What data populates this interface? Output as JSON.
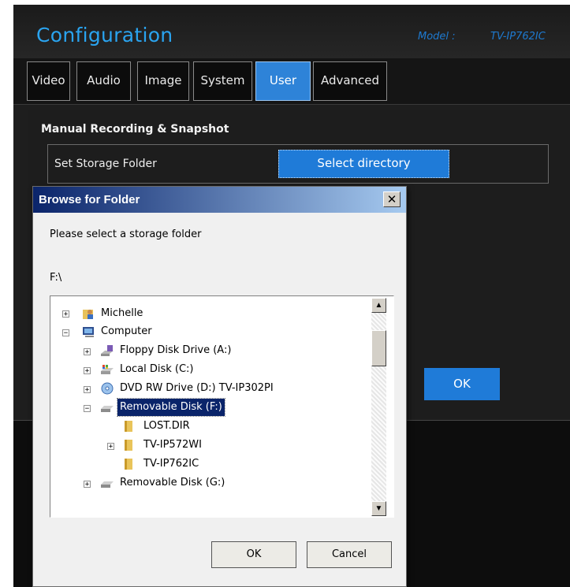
{
  "header": {
    "title": "Configuration",
    "model_label": "Model :",
    "model_value": "TV-IP762IC"
  },
  "tabs": [
    {
      "label": "Video"
    },
    {
      "label": "Audio"
    },
    {
      "label": "Image"
    },
    {
      "label": "System"
    },
    {
      "label": "User",
      "active": true
    },
    {
      "label": "Advanced"
    }
  ],
  "section": {
    "title": "Manual Recording & Snapshot",
    "row_label": "Set Storage Folder",
    "select_button": "Select directory",
    "ok_button": "OK"
  },
  "dialog": {
    "title": "Browse for Folder",
    "close_glyph": "✕",
    "prompt": "Please select a storage folder",
    "path": "F:\\",
    "tree": [
      {
        "label": "Michelle",
        "icon": "user-folder-icon",
        "expander": "+"
      },
      {
        "label": "Computer",
        "icon": "computer-icon",
        "expander": "−"
      },
      {
        "label": "Floppy Disk Drive (A:)",
        "icon": "floppy-drive-icon",
        "expander": "+"
      },
      {
        "label": "Local Disk (C:)",
        "icon": "local-disk-icon",
        "expander": "+"
      },
      {
        "label": "DVD RW Drive (D:) TV-IP302PI",
        "icon": "dvd-drive-icon",
        "expander": "+"
      },
      {
        "label": "Removable Disk (F:)",
        "icon": "removable-disk-icon",
        "expander": "−",
        "selected": true
      },
      {
        "label": "LOST.DIR",
        "icon": "folder-icon",
        "expander": ""
      },
      {
        "label": "TV-IP572WI",
        "icon": "folder-icon",
        "expander": "+"
      },
      {
        "label": "TV-IP762IC",
        "icon": "folder-icon",
        "expander": ""
      },
      {
        "label": "Removable Disk (G:)",
        "icon": "removable-disk-icon",
        "expander": "+"
      }
    ],
    "ok_button": "OK",
    "cancel_button": "Cancel",
    "scroll_up_glyph": "▲",
    "scroll_down_glyph": "▼"
  },
  "colors": {
    "accent_blue": "#2e83d8",
    "title_blue": "#2aa4f0",
    "selection": "#0a246a"
  }
}
